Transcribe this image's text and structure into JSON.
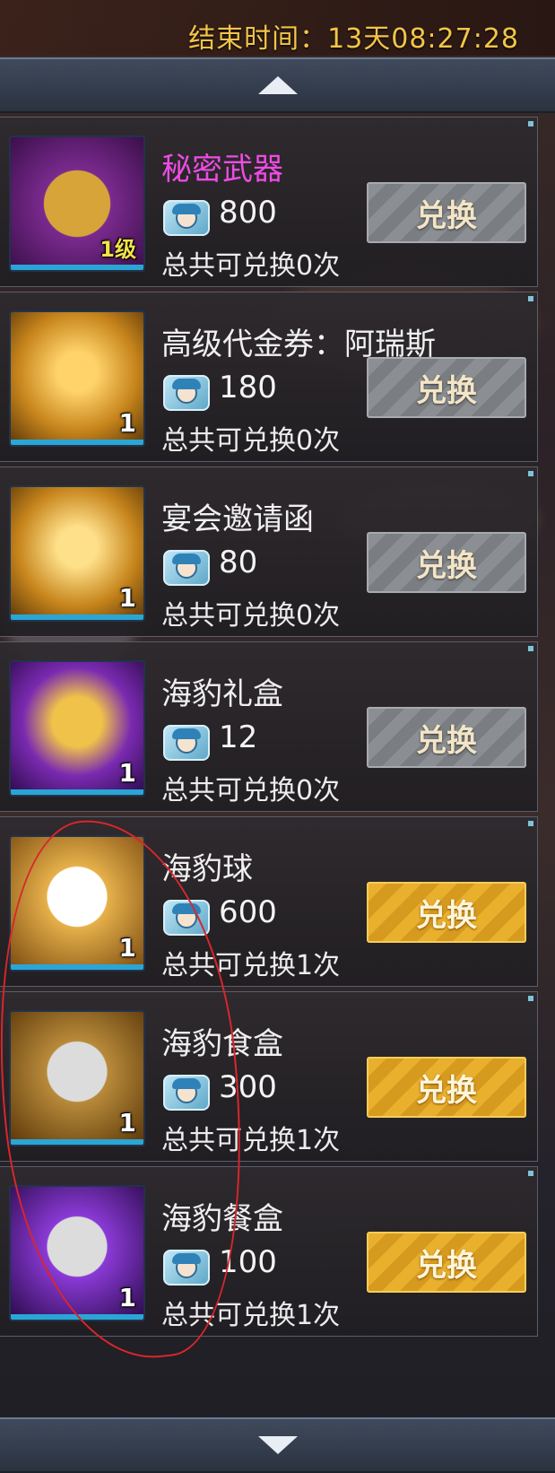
{
  "header": {
    "timer_text": "结束时间：13天08:27:28"
  },
  "colors": {
    "name_special": "#ee4ce4",
    "button_enabled": "#e9b02e",
    "button_disabled": "#8b8f93",
    "timer": "#f3c548",
    "annotation": "#d9262c"
  },
  "currency_icon": "seal-coin-icon",
  "items": [
    {
      "name": "秘密武器",
      "price": "800",
      "limit": "总共可兑换0次",
      "count": "1级",
      "button": "兑换",
      "enabled": false,
      "icon": "durian-icon",
      "name_special": true
    },
    {
      "name": "高级代金券：阿瑞斯",
      "price": "180",
      "limit": "总共可兑换0次",
      "count": "1",
      "button": "兑换",
      "enabled": false,
      "icon": "voucher-cards-icon",
      "name_special": false
    },
    {
      "name": "宴会邀请函",
      "price": "80",
      "limit": "总共可兑换0次",
      "count": "1",
      "button": "兑换",
      "enabled": false,
      "icon": "invitation-card-icon",
      "name_special": false
    },
    {
      "name": "海豹礼盒",
      "price": "12",
      "limit": "总共可兑换0次",
      "count": "1",
      "button": "兑换",
      "enabled": false,
      "icon": "seal-gift-box-icon",
      "name_special": false
    },
    {
      "name": "海豹球",
      "price": "600",
      "limit": "总共可兑换1次",
      "count": "1",
      "button": "兑换",
      "enabled": true,
      "icon": "seal-ball-icon",
      "name_special": false
    },
    {
      "name": "海豹食盒",
      "price": "300",
      "limit": "总共可兑换1次",
      "count": "1",
      "button": "兑换",
      "enabled": true,
      "icon": "seal-food-box-icon",
      "name_special": false
    },
    {
      "name": "海豹餐盒",
      "price": "100",
      "limit": "总共可兑换1次",
      "count": "1",
      "button": "兑换",
      "enabled": true,
      "icon": "seal-meal-box-icon",
      "name_special": false
    }
  ]
}
